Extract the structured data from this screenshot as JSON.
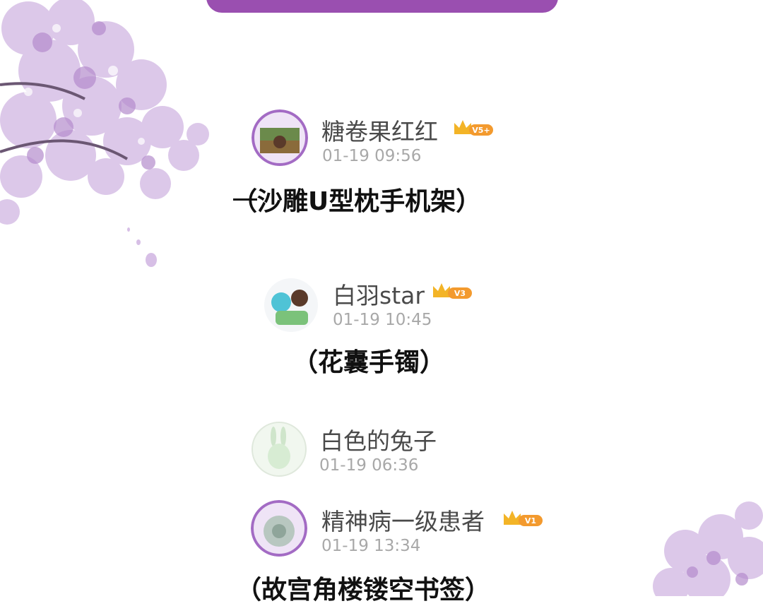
{
  "colors": {
    "header_bar": "#9a4fb0",
    "blossom": "#c9a6dc",
    "badge_orange": "#f39a2e",
    "username": "#4a4a4a",
    "timestamp": "#a8a8a8"
  },
  "posts": [
    {
      "username": "糖卷果红红",
      "level": "V5+",
      "timestamp": "01-19 09:56",
      "item": "（沙雕U型枕手机架）",
      "avatar_frame": "小仙女"
    },
    {
      "username": "白羽star",
      "level": "V3",
      "timestamp": "01-19 10:45",
      "item": "（花囊手镯）"
    },
    {
      "username": "白色的兔子",
      "timestamp": "01-19 06:36"
    },
    {
      "username": "精神病一级患者",
      "level": "V1",
      "timestamp": "01-19 13:34",
      "item": "（故宫角楼镂空书签）",
      "avatar_frame": "小仙女"
    }
  ]
}
